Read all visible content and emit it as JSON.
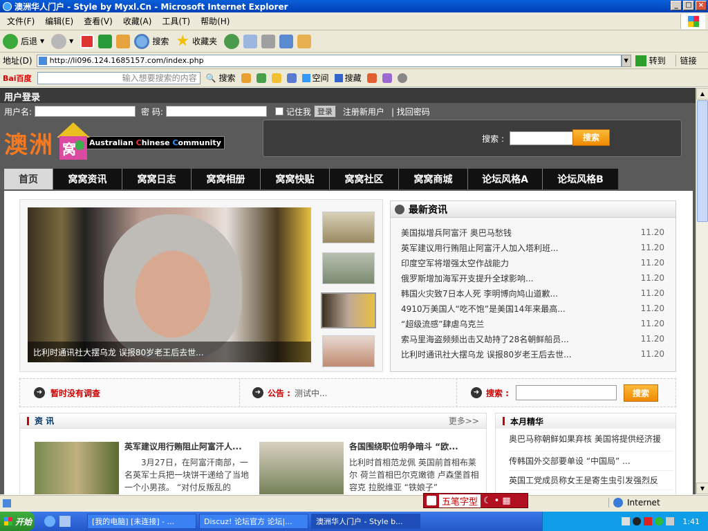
{
  "window": {
    "title": "澳洲华人门户 - Style by Myxl.Cn - Microsoft Internet Explorer"
  },
  "menu": [
    "文件(F)",
    "编辑(E)",
    "查看(V)",
    "收藏(A)",
    "工具(T)",
    "帮助(H)"
  ],
  "toolbar": {
    "back": "后退",
    "search": "搜索",
    "favorites": "收藏夹"
  },
  "address": {
    "label": "地址(D)",
    "url": "http://li096.124.1685157.com/index.php",
    "go": "转到",
    "links": "链接"
  },
  "baidubar": {
    "logo": "Bai百度",
    "placeholder": "输入想要搜索的内容",
    "search": "搜索",
    "space": "空间",
    "bookmark": "搜藏"
  },
  "login": {
    "header": "用户登录",
    "username_label": "用户名:",
    "password_label": "密  码:",
    "remember": "记住我",
    "login_btn": "登录",
    "register": "注册新用户",
    "forgot": "| 找回密码"
  },
  "site": {
    "logo_cn": "澳洲",
    "logo_cn2": "窝",
    "logo_en_a": "Australian ",
    "logo_en_b": "hinese ",
    "logo_en_c": "ommunity",
    "search_label": "搜索 :",
    "search_btn": "搜索"
  },
  "nav": [
    "首页",
    "窝窝资讯",
    "窝窝日志",
    "窝窝相册",
    "窝窝快贴",
    "窝窝社区",
    "窝窝商城",
    "论坛风格A",
    "论坛风格B"
  ],
  "slideshow": {
    "caption": "比利时通讯社大摆乌龙  误报80岁老王后去世..."
  },
  "latest": {
    "title": "最新资讯",
    "items": [
      {
        "t": "美国拟增兵阿富汗  奥巴马愁钱",
        "d": "11.20"
      },
      {
        "t": "英军建议用行贿阻止阿富汗人加入塔利班...",
        "d": "11.20"
      },
      {
        "t": "印度空军将增强太空作战能力",
        "d": "11.20"
      },
      {
        "t": "俄罗斯增加海军开支提升全球影响...",
        "d": "11.20"
      },
      {
        "t": "韩国火灾致7日本人死  李明博向鸠山道歉...",
        "d": "11.20"
      },
      {
        "t": "4910万美国人“吃不饱”是美国14年来最高...",
        "d": "11.20"
      },
      {
        "t": "“超级流感”肆虐乌克兰",
        "d": "11.20"
      },
      {
        "t": "索马里海盗频频出击又劫持了28名朝鲜船员...",
        "d": "11.20"
      },
      {
        "t": "比利时通讯社大摆乌龙  误报80岁老王后去世...",
        "d": "11.20"
      }
    ]
  },
  "infobar": {
    "survey": "暂时没有调查",
    "notice_label": "公告 :",
    "notice": "测试中...",
    "search_label": "搜索 :",
    "search_btn": "搜索"
  },
  "news": {
    "title": "资  讯",
    "more": "更多>>",
    "a1_title": "英军建议用行贿阻止阿富汗人...",
    "a1_body": "3月27日，在阿富汗南部，一名英军士兵把一块饼干递给了当地一个小男孩。  “对付反叛乱的",
    "a2_title": "各国围绕职位明争暗斗  “欧...",
    "a2_body": "比利时首相范龙佩  英国前首相布莱尔  荷兰首相巴尔克嫩德  卢森堡首相容克  拉脱维亚 “铁娘子”"
  },
  "monthly": {
    "title": "本月精华",
    "items": [
      "奥巴马称朝鲜如果弃核  美国将提供经济援",
      "传韩国外交部要单设 “中国局” ...",
      "英国工党成员称女王是寄生虫引发强烈反",
      "...................."
    ]
  },
  "status": {
    "zone": "Internet",
    "ime": "五笔字型"
  },
  "taskbar": {
    "start": "开始",
    "tasks": [
      "[我的电脑] [未连接] - ...",
      "Discuz! 论坛官方 论坛|...",
      "澳洲华人门户 - Style b..."
    ],
    "clock": "1:41"
  },
  "colors": {
    "accent": "#f59b00",
    "title": "#0040b8",
    "navbg": "#111111",
    "pagebg": "#5a5a5a"
  }
}
